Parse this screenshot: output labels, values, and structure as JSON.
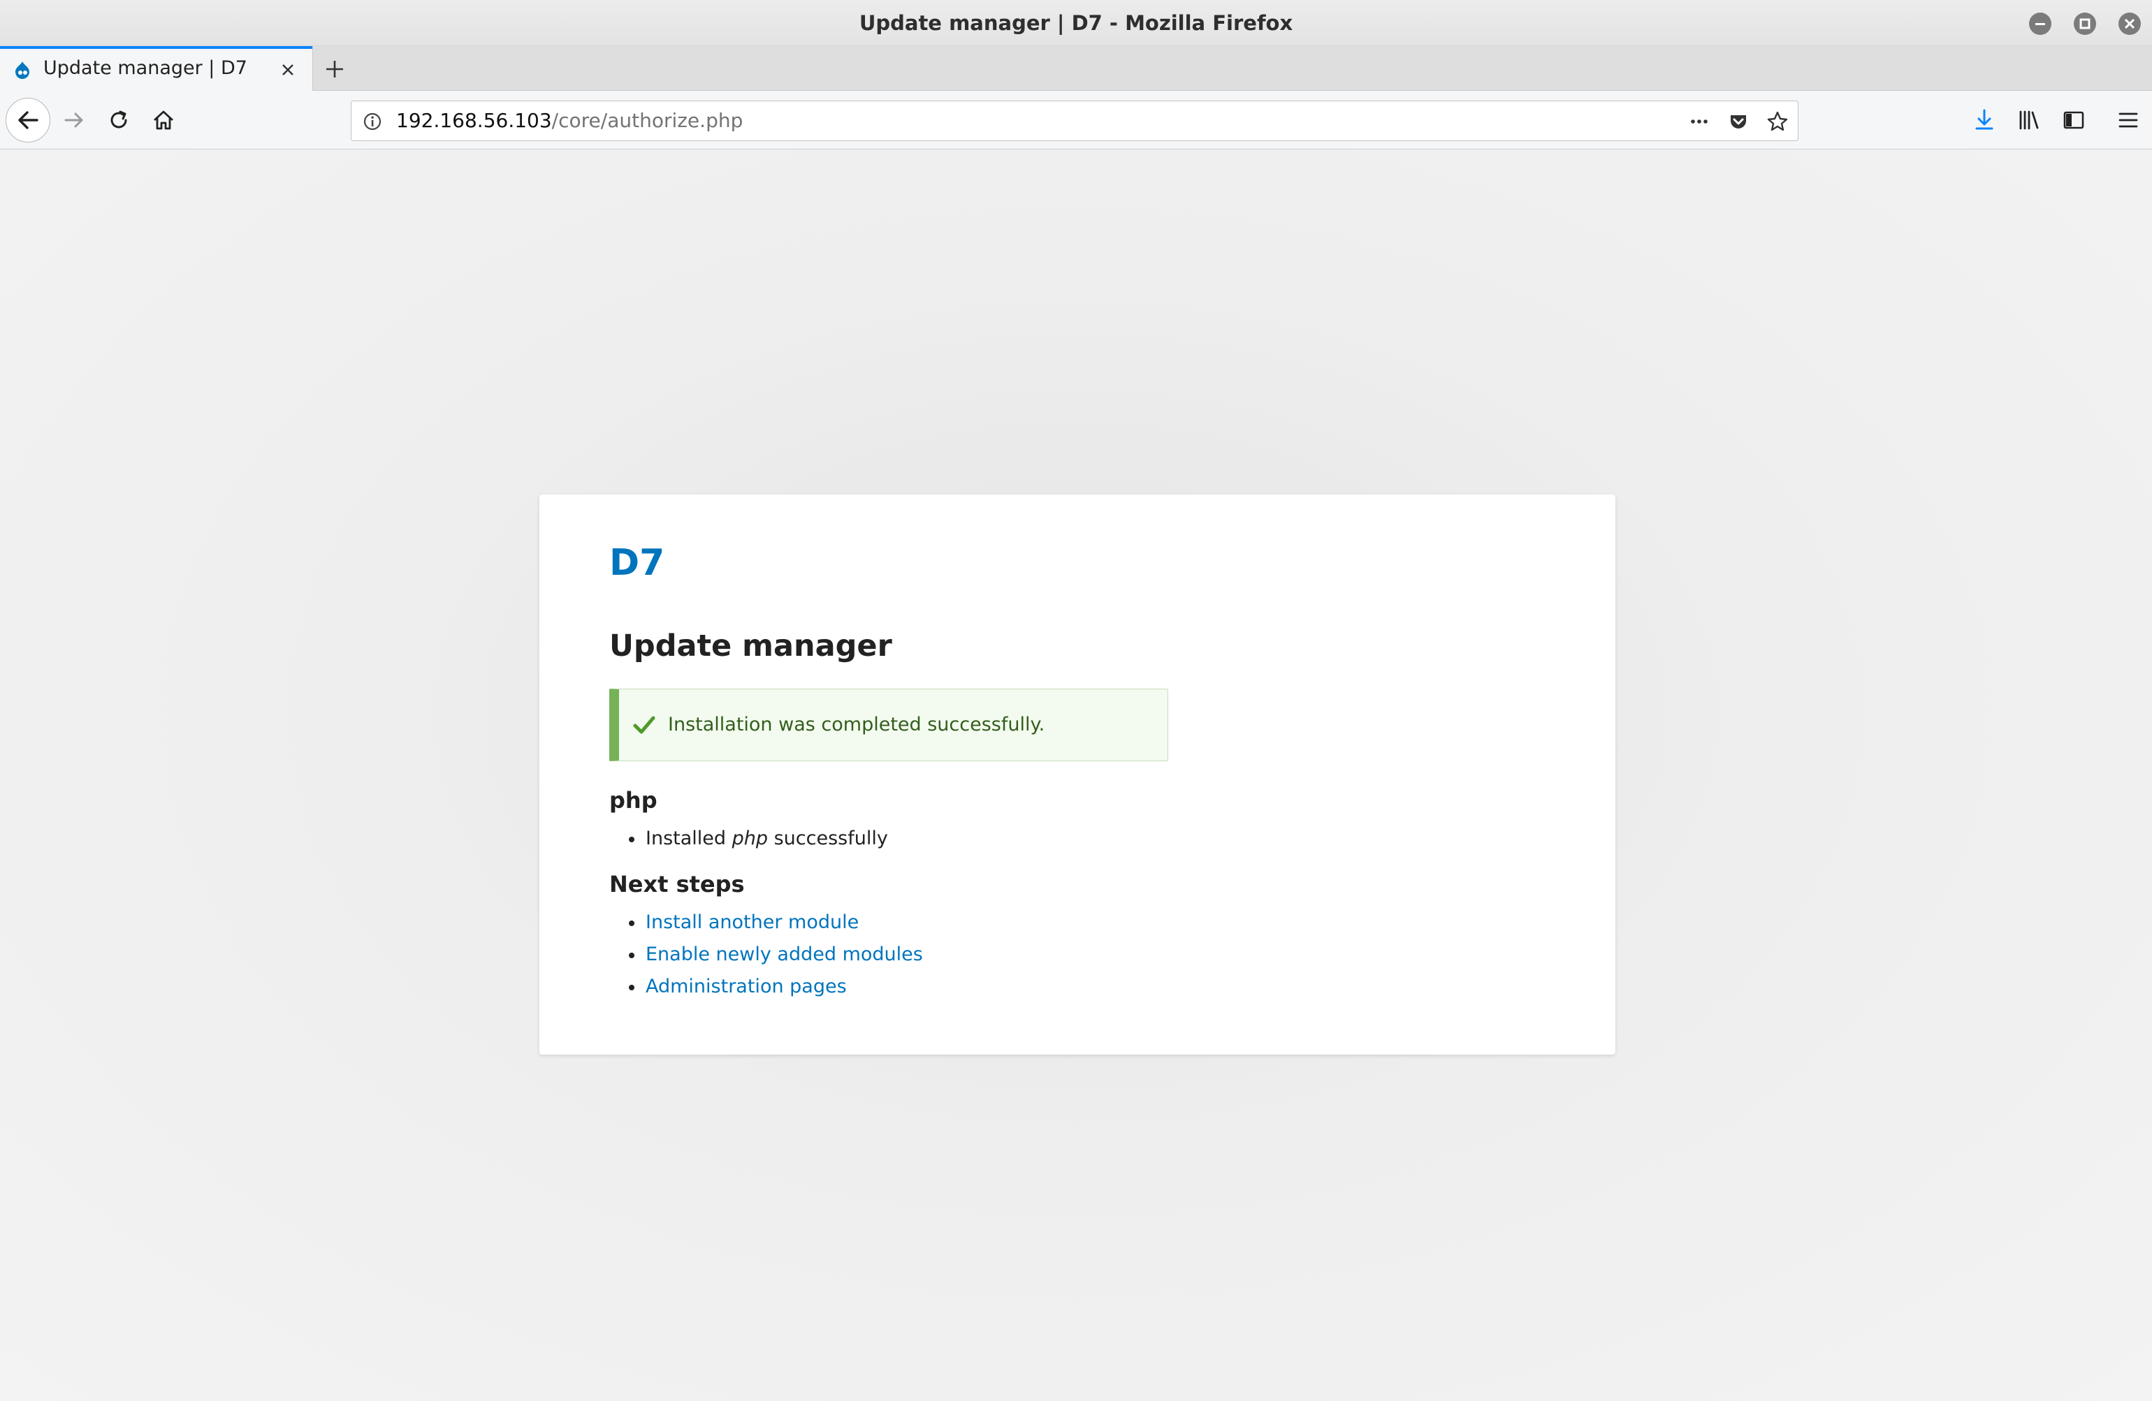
{
  "window": {
    "title": "Update manager | D7 - Mozilla Firefox",
    "controls": [
      "minimize-icon",
      "maximize-icon",
      "close-icon"
    ]
  },
  "tabs": [
    {
      "label": "Update manager | D7",
      "active": true,
      "favicon": "drupal-icon"
    }
  ],
  "toolbar": {
    "url_host": "192.168.56.103",
    "url_path": "/core/authorize.php",
    "accent_color": "#0a84ff"
  },
  "page": {
    "site_name": "D7",
    "title": "Update manager",
    "status_message": "Installation was completed successfully.",
    "status_color": "#77b259",
    "project": {
      "heading": "php",
      "items": [
        {
          "prefix": "Installed ",
          "emphasis": "php",
          "suffix": " successfully"
        }
      ]
    },
    "next_steps": {
      "heading": "Next steps",
      "links": [
        "Install another module",
        "Enable newly added modules",
        "Administration pages"
      ]
    },
    "link_color": "#0074bd"
  }
}
